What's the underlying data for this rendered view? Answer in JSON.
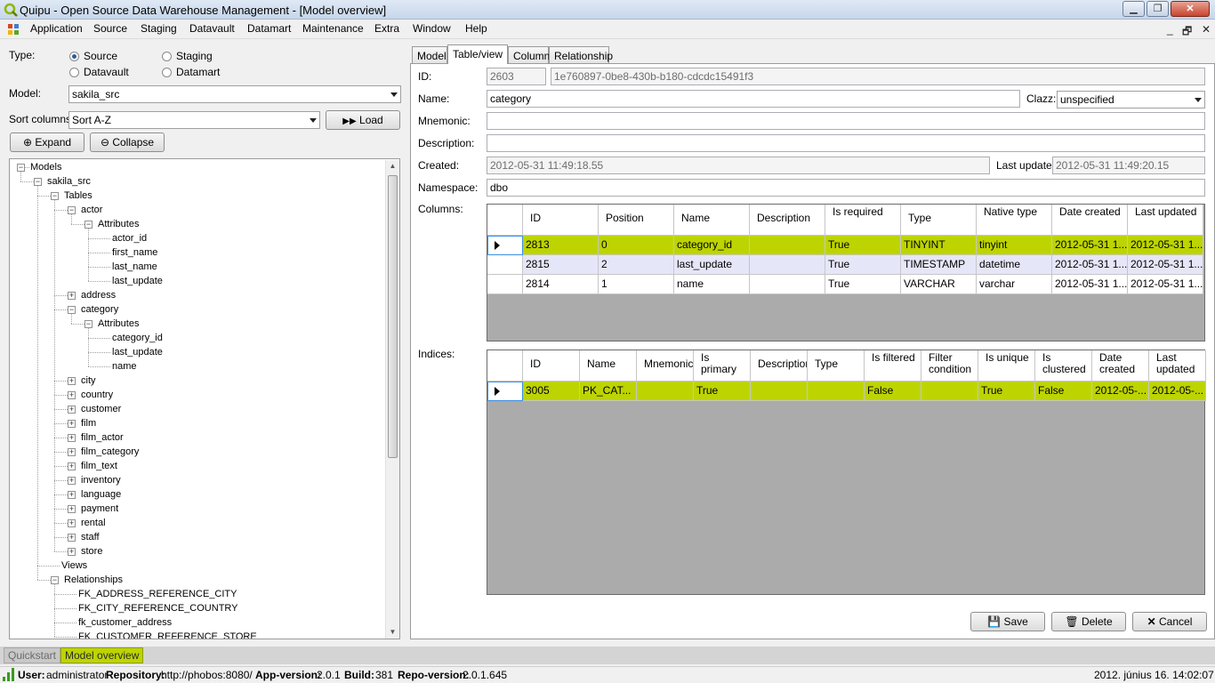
{
  "window": {
    "title": "Quipu - Open Source Data Warehouse Management - [Model overview]",
    "controls": {
      "minimize": "▁",
      "maximize": "❐",
      "close": "✕"
    }
  },
  "menu": {
    "items": [
      "Application",
      "Source",
      "Staging",
      "Datavault",
      "Datamart",
      "Maintenance",
      "Extra",
      "Window",
      "Help"
    ],
    "mdi": {
      "minimize": "_",
      "restore": "🗗",
      "close": "✕"
    }
  },
  "left": {
    "type_label": "Type:",
    "type_options": [
      {
        "label": "Source",
        "selected": true
      },
      {
        "label": "Staging",
        "selected": false
      },
      {
        "label": "Datavault",
        "selected": false
      },
      {
        "label": "Datamart",
        "selected": false
      }
    ],
    "model_label": "Model:",
    "model_value": "sakila_src",
    "sort_label": "Sort columns:",
    "sort_value": "Sort A-Z",
    "load_label": "Load",
    "expand_label": "Expand",
    "collapse_label": "Collapse",
    "tree": [
      {
        "label": "Models",
        "depth": 0,
        "toggle": "-"
      },
      {
        "label": "sakila_src",
        "depth": 1,
        "toggle": "-"
      },
      {
        "label": "Tables",
        "depth": 2,
        "toggle": "-"
      },
      {
        "label": "actor",
        "depth": 3,
        "toggle": "-"
      },
      {
        "label": "Attributes",
        "depth": 4,
        "toggle": "-"
      },
      {
        "label": "actor_id",
        "depth": 5,
        "toggle": ""
      },
      {
        "label": "first_name",
        "depth": 5,
        "toggle": ""
      },
      {
        "label": "last_name",
        "depth": 5,
        "toggle": ""
      },
      {
        "label": "last_update",
        "depth": 5,
        "toggle": ""
      },
      {
        "label": "address",
        "depth": 3,
        "toggle": "+"
      },
      {
        "label": "category",
        "depth": 3,
        "toggle": "-"
      },
      {
        "label": "Attributes",
        "depth": 4,
        "toggle": "-"
      },
      {
        "label": "category_id",
        "depth": 5,
        "toggle": ""
      },
      {
        "label": "last_update",
        "depth": 5,
        "toggle": ""
      },
      {
        "label": "name",
        "depth": 5,
        "toggle": ""
      },
      {
        "label": "city",
        "depth": 3,
        "toggle": "+"
      },
      {
        "label": "country",
        "depth": 3,
        "toggle": "+"
      },
      {
        "label": "customer",
        "depth": 3,
        "toggle": "+"
      },
      {
        "label": "film",
        "depth": 3,
        "toggle": "+"
      },
      {
        "label": "film_actor",
        "depth": 3,
        "toggle": "+"
      },
      {
        "label": "film_category",
        "depth": 3,
        "toggle": "+"
      },
      {
        "label": "film_text",
        "depth": 3,
        "toggle": "+"
      },
      {
        "label": "inventory",
        "depth": 3,
        "toggle": "+"
      },
      {
        "label": "language",
        "depth": 3,
        "toggle": "+"
      },
      {
        "label": "payment",
        "depth": 3,
        "toggle": "+"
      },
      {
        "label": "rental",
        "depth": 3,
        "toggle": "+"
      },
      {
        "label": "staff",
        "depth": 3,
        "toggle": "+"
      },
      {
        "label": "store",
        "depth": 3,
        "toggle": "+"
      },
      {
        "label": "Views",
        "depth": 2,
        "toggle": ""
      },
      {
        "label": "Relationships",
        "depth": 2,
        "toggle": "-"
      },
      {
        "label": "FK_ADDRESS_REFERENCE_CITY",
        "depth": 3,
        "toggle": ""
      },
      {
        "label": "FK_CITY_REFERENCE_COUNTRY",
        "depth": 3,
        "toggle": ""
      },
      {
        "label": "fk_customer_address",
        "depth": 3,
        "toggle": ""
      },
      {
        "label": "FK_CUSTOMER_REFERENCE_STORE",
        "depth": 3,
        "toggle": ""
      }
    ]
  },
  "tabs": [
    "Model",
    "Table/view",
    "Column",
    "Relationship"
  ],
  "active_tab": 1,
  "form": {
    "id_label": "ID:",
    "id_value": "2603",
    "guid_value": "1e760897-0be8-430b-b180-cdcdc15491f3",
    "name_label": "Name:",
    "name_value": "category",
    "clazz_label": "Clazz:",
    "clazz_value": "unspecified",
    "mnemonic_label": "Mnemonic:",
    "mnemonic_value": "",
    "description_label": "Description:",
    "description_value": "",
    "created_label": "Created:",
    "created_value": "2012-05-31 11:49:18.55",
    "lastupdate_label": "Last update:",
    "lastupdate_value": "2012-05-31 11:49:20.15",
    "namespace_label": "Namespace:",
    "namespace_value": "dbo",
    "columns_label": "Columns:",
    "indices_label": "Indices:"
  },
  "columns_grid": {
    "headers": [
      "ID",
      "Position",
      "Name",
      "Description",
      "Is required",
      "Type",
      "Native type",
      "Date created",
      "Last updated"
    ],
    "rows": [
      [
        "2813",
        "0",
        "category_id",
        "",
        "True",
        "TINYINT",
        "tinyint",
        "2012-05-31 1...",
        "2012-05-31 1..."
      ],
      [
        "2815",
        "2",
        "last_update",
        "",
        "True",
        "TIMESTAMP",
        "datetime",
        "2012-05-31 1...",
        "2012-05-31 1..."
      ],
      [
        "2814",
        "1",
        "name",
        "",
        "True",
        "VARCHAR",
        "varchar",
        "2012-05-31 1...",
        "2012-05-31 1..."
      ]
    ]
  },
  "indices_grid": {
    "headers": [
      "ID",
      "Name",
      "Mnemonic",
      "Is primary",
      "Description",
      "Type",
      "Is filtered",
      "Filter condition",
      "Is unique",
      "Is clustered",
      "Date created",
      "Last updated"
    ],
    "rows": [
      [
        "3005",
        "PK_CAT...",
        "",
        "True",
        "",
        "",
        "False",
        "",
        "True",
        "False",
        "2012-05-...",
        "2012-05-..."
      ]
    ]
  },
  "buttons": {
    "save": "Save",
    "delete": "Delete",
    "cancel": "Cancel"
  },
  "doc_tabs": [
    "Quickstart",
    "Model overview"
  ],
  "status": {
    "user_label": "User:",
    "user_value": "administrator",
    "repo_label": "Repository:",
    "repo_value": "http://phobos:8080/",
    "appver_label": "App-version:",
    "appver_value": "2.0.1",
    "build_label": "Build:",
    "build_value": "381",
    "repover_label": "Repo-version:",
    "repover_value": "2.0.1.645",
    "datetime": "2012. június 16. 14:02:07"
  },
  "colors": {
    "selection": "#bdd400",
    "alt_row": "#e6e6f9",
    "doc_tab_active": "#bdd400"
  }
}
